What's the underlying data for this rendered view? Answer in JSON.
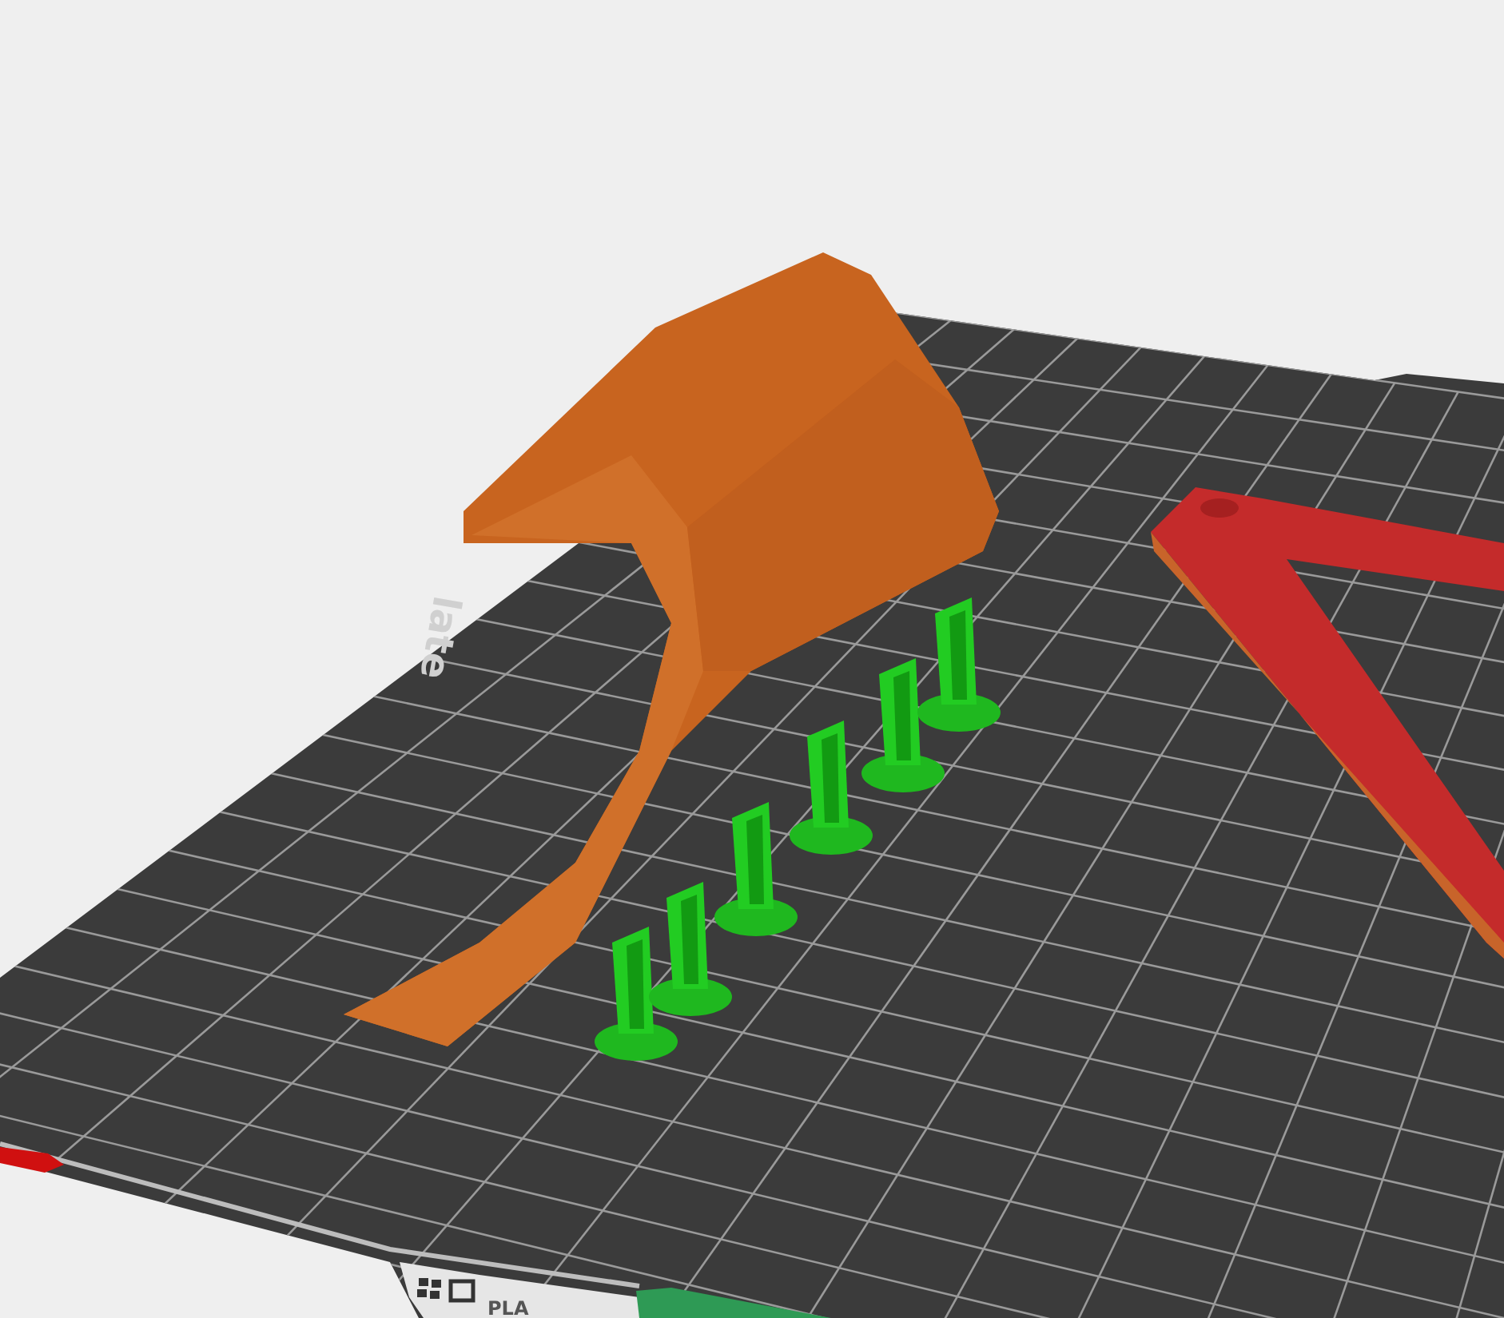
{
  "viewport": {
    "bed_label": "late",
    "filament_tag": "PLA"
  }
}
